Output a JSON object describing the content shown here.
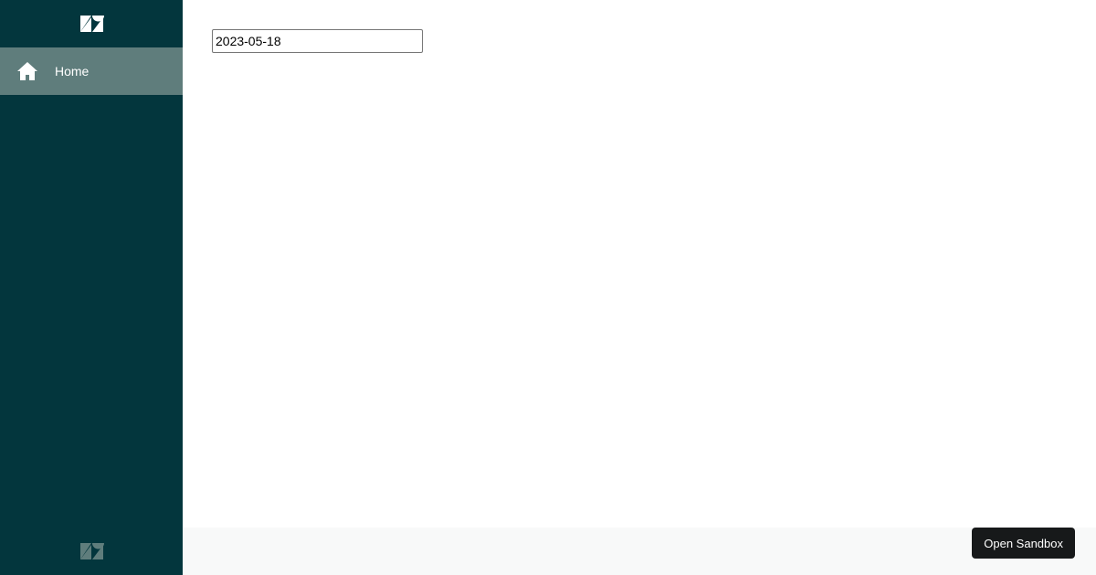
{
  "colors": {
    "sidebar_bg": "#03363d",
    "nav_active_bg": "#5f7d7c",
    "footer_bg": "#f8f9f9",
    "button_bg": "#17191a"
  },
  "sidebar": {
    "brand_icon": "zendesk-logo-icon",
    "items": [
      {
        "label": "Home",
        "icon": "home-icon",
        "active": true
      }
    ],
    "footer_icon": "zendesk-logo-icon"
  },
  "main": {
    "date_input": {
      "value": "2023-05-18"
    }
  },
  "footer": {
    "open_sandbox_label": "Open Sandbox"
  }
}
